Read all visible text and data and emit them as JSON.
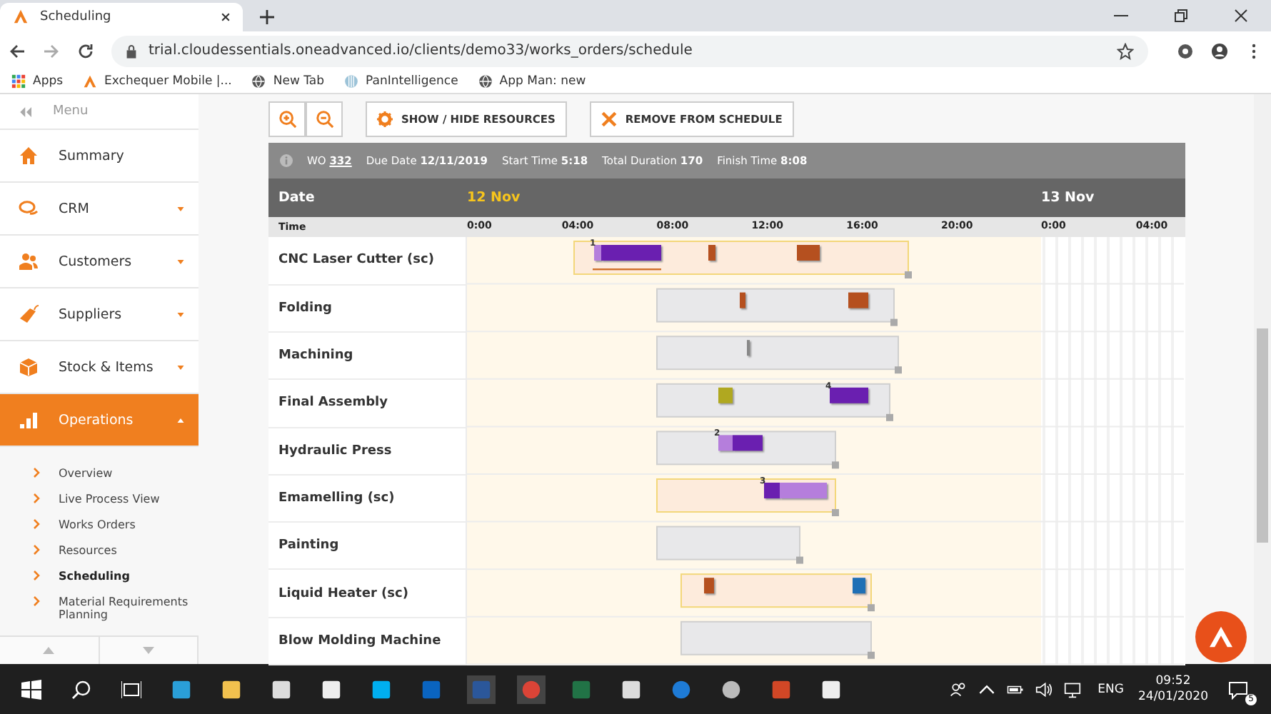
{
  "browser": {
    "tab_title": "Scheduling",
    "url": "trial.cloudessentials.oneadvanced.io/clients/demo33/works_orders/schedule",
    "bookmarks": [
      {
        "label": "Apps",
        "kind": "apps"
      },
      {
        "label": "Exchequer Mobile |...",
        "kind": "brand"
      },
      {
        "label": "New Tab",
        "kind": "globe"
      },
      {
        "label": "PanIntelligence",
        "kind": "pan"
      },
      {
        "label": "App Man: new",
        "kind": "globe"
      }
    ]
  },
  "sidebar": {
    "menu_label": "Menu",
    "items": [
      {
        "label": "Summary",
        "kind": "home",
        "selected": false
      },
      {
        "label": "CRM",
        "kind": "chat",
        "selected": false,
        "expanded": false
      },
      {
        "label": "Customers",
        "kind": "people",
        "selected": false,
        "expanded": false
      },
      {
        "label": "Suppliers",
        "kind": "tag",
        "selected": false,
        "expanded": false
      },
      {
        "label": "Stock & Items",
        "kind": "box",
        "selected": false,
        "expanded": false
      },
      {
        "label": "Operations",
        "kind": "chart",
        "selected": true,
        "expanded": true
      }
    ],
    "subitems": [
      {
        "label": "Overview",
        "selected": false
      },
      {
        "label": "Live Process View",
        "selected": false
      },
      {
        "label": "Works Orders",
        "selected": false
      },
      {
        "label": "Resources",
        "selected": false
      },
      {
        "label": "Scheduling",
        "selected": true
      },
      {
        "label": "Material Requirements Planning",
        "selected": false
      }
    ]
  },
  "toolbar": {
    "buttons": [
      {
        "label": "SHOW / HIDE RESOURCES",
        "kind": "gear"
      },
      {
        "label": "REMOVE FROM SCHEDULE",
        "kind": "cross"
      }
    ]
  },
  "info_bar": {
    "fields": [
      {
        "label": "WO",
        "value": "332",
        "link": true
      },
      {
        "label": "Due Date",
        "value": "12/11/2019",
        "link": false
      },
      {
        "label": "Start Time",
        "value": "5:18",
        "link": false
      },
      {
        "label": "Total Duration",
        "value": "170",
        "link": false
      },
      {
        "label": "Finish Time",
        "value": "8:08",
        "link": false
      }
    ]
  },
  "schedule": {
    "date_label": "Date",
    "dates": [
      {
        "label": "12 Nov",
        "selected": true
      },
      {
        "label": "13 Nov",
        "selected": false
      }
    ],
    "time_label": "Time",
    "time_ticks": [
      "0:00",
      "04:00",
      "08:00",
      "12:00",
      "16:00",
      "20:00",
      "0:00",
      "04:00"
    ],
    "resources": [
      "CNC Laser Cutter (sc)",
      "Folding",
      "Machining",
      "Final Assembly",
      "Hydraulic Press",
      "Emamelling (sc)",
      "Painting",
      "Liquid Heater (sc)",
      "Blow Molding Machine"
    ],
    "sequence_numbers": [
      "1",
      "4",
      "2",
      "3"
    ]
  },
  "taskbar": {
    "language": "ENG",
    "time": "09:52",
    "date": "24/01/2020",
    "notifications": "5"
  }
}
